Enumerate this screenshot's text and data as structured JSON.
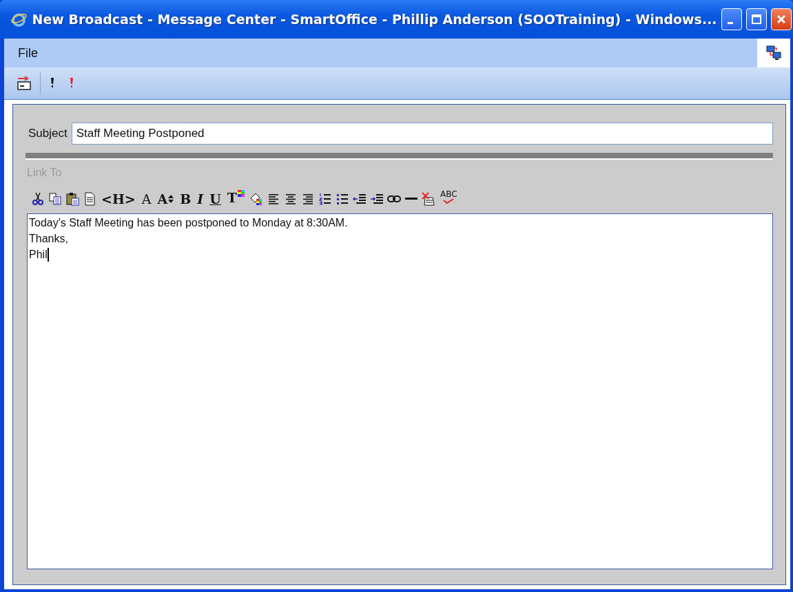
{
  "window": {
    "title": "New Broadcast - Message Center - SmartOffice - Phillip Anderson (SOOTraining) - Windows..."
  },
  "menu": [
    "File"
  ],
  "toolbar": [
    {
      "kind": "send"
    },
    {
      "kind": "separator"
    },
    {
      "kind": "priority-normal"
    },
    {
      "kind": "priority-high"
    }
  ],
  "subject": {
    "label": "Subject",
    "value": "Staff Meeting Postponed"
  },
  "link_to": {
    "label": "Link To",
    "disabled": true
  },
  "editor_toolbar": [
    {
      "kind": "cut"
    },
    {
      "kind": "copy"
    },
    {
      "kind": "paste"
    },
    {
      "kind": "new"
    },
    {
      "kind": "heading",
      "glyph": "<H>"
    },
    {
      "kind": "font",
      "glyph": "A"
    },
    {
      "kind": "font-size",
      "glyph": "A"
    },
    {
      "kind": "bold",
      "glyph": "B"
    },
    {
      "kind": "italic",
      "glyph": "I"
    },
    {
      "kind": "underline",
      "glyph": "U"
    },
    {
      "kind": "text-color",
      "glyph": "T"
    },
    {
      "kind": "fill-color"
    },
    {
      "kind": "align-left"
    },
    {
      "kind": "align-center"
    },
    {
      "kind": "align-right"
    },
    {
      "kind": "numbered-list"
    },
    {
      "kind": "bullet-list"
    },
    {
      "kind": "outdent"
    },
    {
      "kind": "indent"
    },
    {
      "kind": "link"
    },
    {
      "kind": "rule"
    },
    {
      "kind": "clear"
    },
    {
      "kind": "spellcheck",
      "glyph": "ABC"
    }
  ],
  "body": {
    "lines": [
      "Today's Staff Meeting has been postponed to Monday at 8:30AM.",
      "Thanks,",
      "Phil"
    ],
    "caret": true
  }
}
